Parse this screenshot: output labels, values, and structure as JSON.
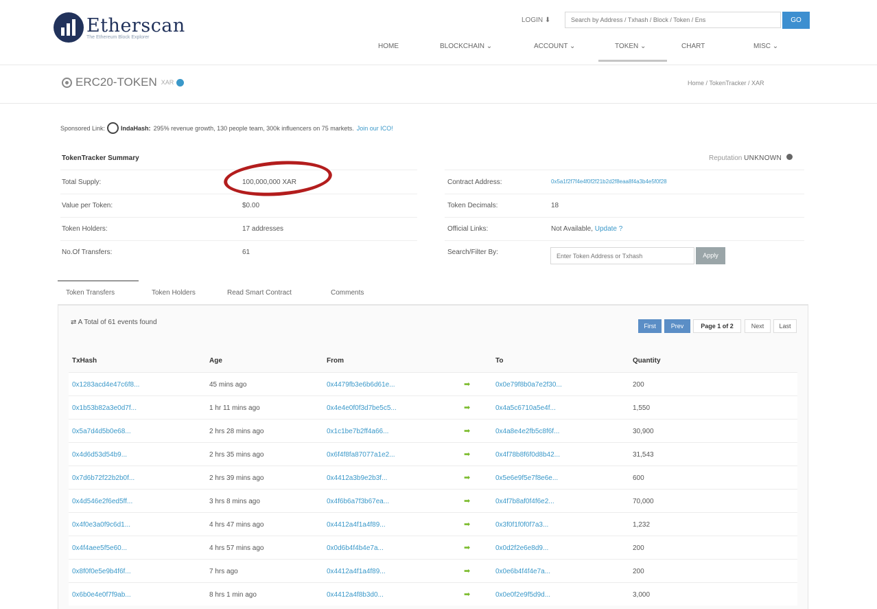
{
  "brand": {
    "name": "Etherscan",
    "tagline": "The Ethereum Block Explorer"
  },
  "header": {
    "login_label": "LOGIN ⬇",
    "search_placeholder": "Search by Address / Txhash / Block / Token / Ens",
    "go_label": "GO",
    "nav": [
      "HOME",
      "BLOCKCHAIN ⌄",
      "ACCOUNT ⌄",
      "TOKEN ⌄",
      "CHART",
      "MISC ⌄"
    ]
  },
  "page": {
    "title": "ERC20-TOKEN",
    "symbol": "XAR",
    "breadcrumb": "Home / TokenTracker / XAR"
  },
  "sponsored": {
    "label": "Sponsored Link:",
    "name": "IndaHash:",
    "text": "295% revenue growth, 130 people team, 300k influencers on 75 markets.",
    "link": "Join our ICO!"
  },
  "summary": {
    "title": "TokenTracker Summary",
    "reputation_label": "Reputation",
    "reputation_value": "UNKNOWN",
    "left": [
      {
        "label": "Total Supply:",
        "value": "100,000,000 XAR"
      },
      {
        "label": "Value per Token:",
        "value": "$0.00"
      },
      {
        "label": "Token Holders:",
        "value": "17 addresses"
      },
      {
        "label": "No.Of Transfers:",
        "value": "61"
      }
    ],
    "right": [
      {
        "label": "Contract Address:",
        "value": "0x5a1f2f7f4e4f0f2f21b2d2f8eaa8f4a3b4e5f0f28"
      },
      {
        "label": "Token Decimals:",
        "value": "18"
      },
      {
        "label": "Official Links:",
        "value": "Not Available,",
        "link": "Update ?"
      },
      {
        "label": "Search/Filter By:",
        "placeholder": "Enter Token Address or Txhash",
        "button": "Apply"
      }
    ]
  },
  "tabs": [
    "Token Transfers",
    "Token Holders",
    "Read Smart Contract",
    "Comments"
  ],
  "transfers": {
    "total_text": "⇄ A Total of 61 events found",
    "pager": {
      "first": "First",
      "prev": "Prev",
      "page": "Page 1 of 2",
      "next": "Next",
      "last": "Last"
    },
    "columns": [
      "TxHash",
      "Age",
      "From",
      "",
      "To",
      "Quantity"
    ],
    "rows": [
      {
        "hash": "0x1283acd4e47c6f8...",
        "age": "45 mins ago",
        "from": "0x4479fb3e6b6d61e...",
        "to": "0x0e79f8b0a7e2f30...",
        "qty": "200"
      },
      {
        "hash": "0x1b53b82a3e0d7f...",
        "age": "1 hr 11 mins ago",
        "from": "0x4e4e0f0f3d7be5c5...",
        "to": "0x4a5c6710a5e4f...",
        "qty": "1,550"
      },
      {
        "hash": "0x5a7d4d5b0e68...",
        "age": "2 hrs 28 mins ago",
        "from": "0x1c1be7b2ff4a66...",
        "to": "0x4a8e4e2fb5c8f6f...",
        "qty": "30,900"
      },
      {
        "hash": "0x4d6d53d54b9...",
        "age": "2 hrs 35 mins ago",
        "from": "0x6f4f8fa87077a1e2...",
        "to": "0x4f78b8f6f0d8b42...",
        "qty": "31,543"
      },
      {
        "hash": "0x7d6b72f22b2b0f...",
        "age": "2 hrs 39 mins ago",
        "from": "0x4412a3b9e2b3f...",
        "to": "0x5e6e9f5e7f8e6e...",
        "qty": "600"
      },
      {
        "hash": "0x4d546e2f6ed5ff...",
        "age": "3 hrs 8 mins ago",
        "from": "0x4f6b6a7f3b67ea...",
        "to": "0x4f7b8af0f4f6e2...",
        "qty": "70,000"
      },
      {
        "hash": "0x4f0e3a0f9c6d1...",
        "age": "4 hrs 47 mins ago",
        "from": "0x4412a4f1a4f89...",
        "to": "0x3f0f1f0f0f7a3...",
        "qty": "1,232"
      },
      {
        "hash": "0x4f4aee5f5e60...",
        "age": "4 hrs 57 mins ago",
        "from": "0x0d6b4f4b4e7a...",
        "to": "0x0d2f2e6e8d9...",
        "qty": "200"
      },
      {
        "hash": "0x8f0f0e5e9b4f6f...",
        "age": "7 hrs ago",
        "from": "0x4412a4f1a4f89...",
        "to": "0x0e6b4f4f4e7a...",
        "qty": "200"
      },
      {
        "hash": "0x6b0e4e0f7f9ab...",
        "age": "8 hrs 1 min ago",
        "from": "0x4412a4f8b3d0...",
        "to": "0x0e0f2e9f5d9d...",
        "qty": "3,000"
      }
    ]
  }
}
